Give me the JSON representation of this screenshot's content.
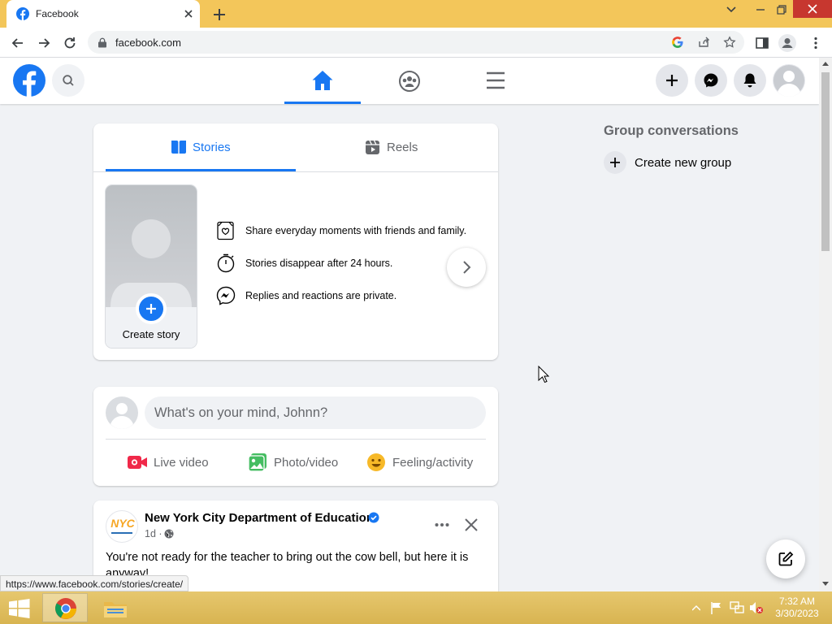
{
  "browser": {
    "tab_title": "Facebook",
    "url": "facebook.com",
    "status_url": "https://www.facebook.com/stories/create/"
  },
  "stories_card": {
    "tabs": [
      {
        "label": "Stories"
      },
      {
        "label": "Reels"
      }
    ],
    "create_story_label": "Create story",
    "info_items": [
      {
        "text": "Share everyday moments with friends and family."
      },
      {
        "text": "Stories disappear after 24 hours."
      },
      {
        "text": "Replies and reactions are private."
      }
    ]
  },
  "composer": {
    "placeholder": "What's on your mind, Johnn?",
    "actions": [
      {
        "label": "Live video"
      },
      {
        "label": "Photo/video"
      },
      {
        "label": "Feeling/activity"
      }
    ]
  },
  "post": {
    "author": "New York City Department of Education",
    "time": "1d ·",
    "text": "You're not ready for the teacher to bring out the cow bell, but here it is anyway!",
    "avatar_text": "NYC"
  },
  "right": {
    "group_heading": "Group conversations",
    "create_group": "Create new group"
  },
  "taskbar": {
    "time": "7:32 AM",
    "date": "3/30/2023"
  },
  "colors": {
    "brand": "#1877f2",
    "chrome_frame": "#f3c65a"
  }
}
